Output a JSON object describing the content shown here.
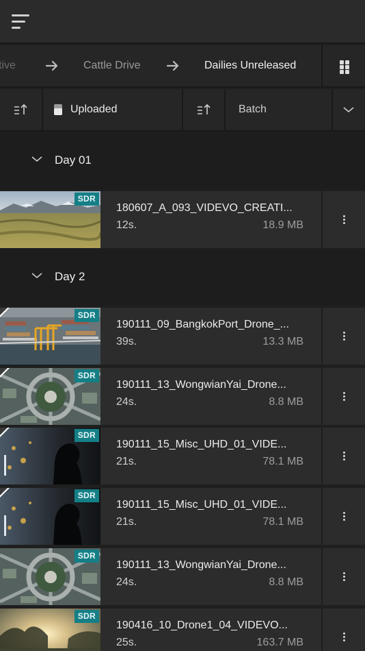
{
  "breadcrumb": [
    {
      "label": "tive"
    },
    {
      "label": "Cattle Drive"
    },
    {
      "label": "Dailies Unreleased"
    }
  ],
  "filters": {
    "status_label": "Uploaded",
    "batch_label": "Batch"
  },
  "groups": [
    {
      "label": "Day 01"
    },
    {
      "label": "Day 2"
    }
  ],
  "clips": [
    {
      "badge": "SDR",
      "name": "180607_A_093_VIDEVO_CREATI...",
      "duration": "12s.",
      "size": "18.9 MB",
      "thumb": "grassland-aerial"
    },
    {
      "badge": "SDR",
      "name": "190111_09_BangkokPort_Drone_...",
      "duration": "39s.",
      "size": "13.3 MB",
      "thumb": "port-cranes"
    },
    {
      "badge": "SDR",
      "name": "190111_13_WongwianYai_Drone...",
      "duration": "24s.",
      "size": "8.8 MB",
      "thumb": "roundabout-aerial"
    },
    {
      "badge": "SDR",
      "name": "190111_15_Misc_UHD_01_VIDE...",
      "duration": "21s.",
      "size": "78.1 MB",
      "thumb": "night-silhouette"
    },
    {
      "badge": "SDR",
      "name": "190111_15_Misc_UHD_01_VIDE...",
      "duration": "21s.",
      "size": "78.1 MB",
      "thumb": "night-silhouette"
    },
    {
      "badge": "SDR",
      "name": "190111_13_WongwianYai_Drone...",
      "duration": "24s.",
      "size": "8.8 MB",
      "thumb": "roundabout-aerial"
    },
    {
      "badge": "SDR",
      "name": "190416_10_Drone1_04_VIDEVO...",
      "duration": "25s.",
      "size": "163.7 MB",
      "thumb": "sunset-trees"
    }
  ],
  "icons": {
    "menu": "hamburger-menu-icon",
    "arrow": "arrow-right-icon",
    "grid": "grid-view-icon",
    "sort": "sort-ascending-icon",
    "status": "upload-status-icon",
    "chevron": "chevron-down-icon",
    "more": "more-vertical-icon"
  },
  "colors": {
    "badge": "#157f86",
    "background": "#1f1f1f",
    "row": "#2c2c2c"
  }
}
